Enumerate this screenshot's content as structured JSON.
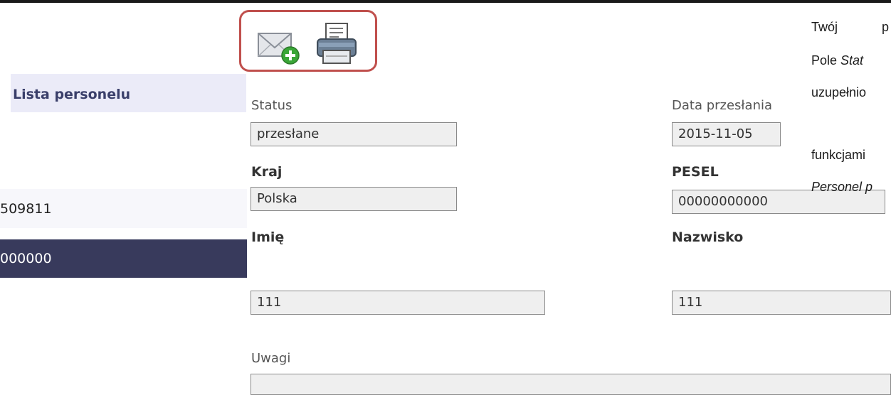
{
  "list": {
    "header": "Lista personelu",
    "rows": [
      {
        "id": "509811"
      },
      {
        "id": "000000"
      }
    ]
  },
  "toolbar": {
    "send_icon": "envelope-plus-icon",
    "print_icon": "printer-icon"
  },
  "form": {
    "status_label": "Status",
    "status_value": "przesłane",
    "date_label": "Data przesłania",
    "date_value": "2015-11-05",
    "country_label": "Kraj",
    "country_value": "Polska",
    "pesel_label": "PESEL",
    "pesel_value": "00000000000",
    "first_name_label": "Imię",
    "first_name_value": "111",
    "last_name_label": "Nazwisko",
    "last_name_value": "111",
    "notes_label": "Uwagi",
    "notes_value": ""
  },
  "doc": {
    "line1_a": "Twój",
    "line1_b": "p",
    "line2_a": "Pole ",
    "line2_b": "Stat",
    "line3": "uzupełnio",
    "line4": "funkcjami",
    "line5": "Personel p"
  },
  "colors": {
    "highlight_border": "#c0504d",
    "selected_row": "#383a5c",
    "list_header_bg": "#ebebf8"
  }
}
